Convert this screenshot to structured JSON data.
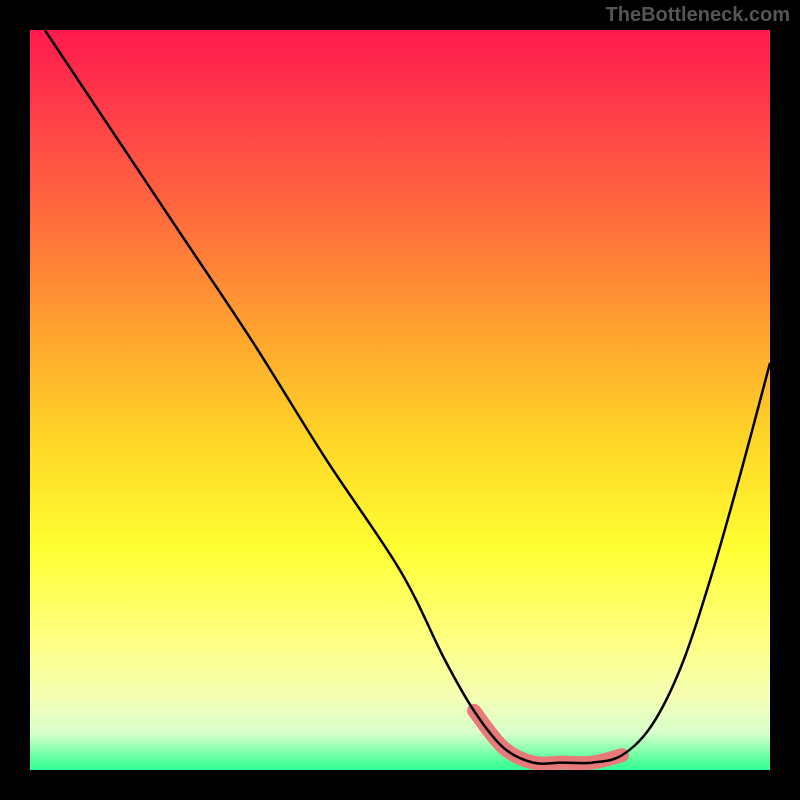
{
  "watermark": "TheBottleneck.com",
  "chart_data": {
    "type": "line",
    "title": "",
    "xlabel": "",
    "ylabel": "",
    "xlim": [
      0,
      100
    ],
    "ylim": [
      0,
      100
    ],
    "series": [
      {
        "name": "bottleneck-curve",
        "x": [
          2,
          10,
          20,
          30,
          40,
          50,
          56,
          60,
          64,
          68,
          72,
          76,
          80,
          84,
          88,
          92,
          96,
          100
        ],
        "y": [
          100,
          88,
          73,
          58,
          42,
          27,
          15,
          8,
          3,
          1,
          1,
          1,
          2,
          6,
          14,
          26,
          40,
          55
        ]
      }
    ],
    "annotations": [
      {
        "name": "trough-band",
        "x_start": 58,
        "x_end": 80,
        "color": "#e87a7a"
      }
    ],
    "background_gradient": {
      "stops": [
        {
          "pos": 0,
          "color": "#ff1a4d"
        },
        {
          "pos": 25,
          "color": "#ff6b3d"
        },
        {
          "pos": 55,
          "color": "#ffd426"
        },
        {
          "pos": 82,
          "color": "#ffff80"
        },
        {
          "pos": 100,
          "color": "#33ff99"
        }
      ]
    }
  }
}
